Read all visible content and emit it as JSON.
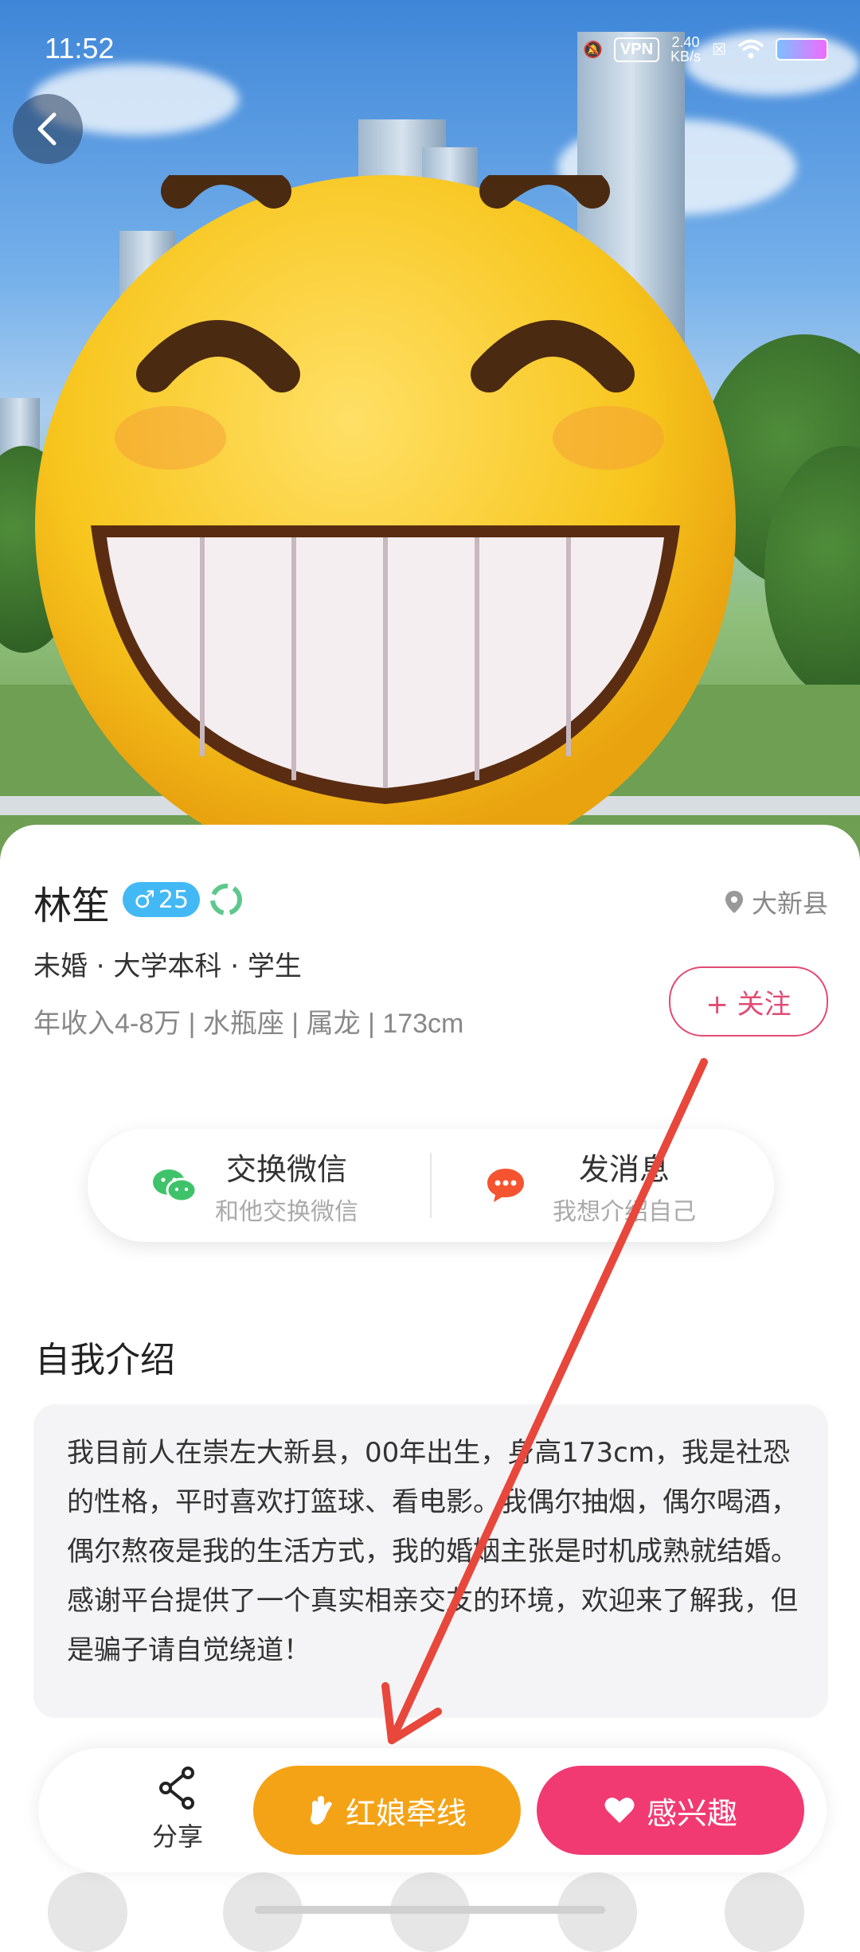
{
  "status_bar": {
    "time": "11:52",
    "vpn": "VPN",
    "speed_value": "2.40",
    "speed_unit": "KB/s"
  },
  "profile": {
    "name": "林笙",
    "gender_symbol": "♂",
    "age": "25",
    "location": "大新县",
    "tags": "未婚 · 大学本科 · 学生",
    "info": "年收入4-8万 | 水瓶座 | 属龙 | 173cm",
    "follow_label": "+ 关注"
  },
  "actions": {
    "wechat": {
      "title": "交换微信",
      "subtitle": "和他交换微信"
    },
    "message": {
      "title": "发消息",
      "subtitle": "我想介绍自己"
    }
  },
  "intro": {
    "title": "自我介绍",
    "text": "我目前人在崇左大新县，00年出生，身高173cm，我是社恐的性格，平时喜欢打篮球、看电影。我偶尔抽烟，偶尔喝酒，偶尔熬夜是我的生活方式，我的婚姻主张是时机成熟就结婚。感谢平台提供了一个真实相亲交友的环境，欢迎来了解我，但是骗子请自觉绕道！"
  },
  "bottom_bar": {
    "share_label": "分享",
    "matchmaker_label": "红娘牵线",
    "interest_label": "感兴趣"
  },
  "colors": {
    "accent_pink": "#f13a72",
    "accent_orange": "#f5a316",
    "badge_blue": "#42b9f5",
    "annotation_red": "#e8473c"
  }
}
